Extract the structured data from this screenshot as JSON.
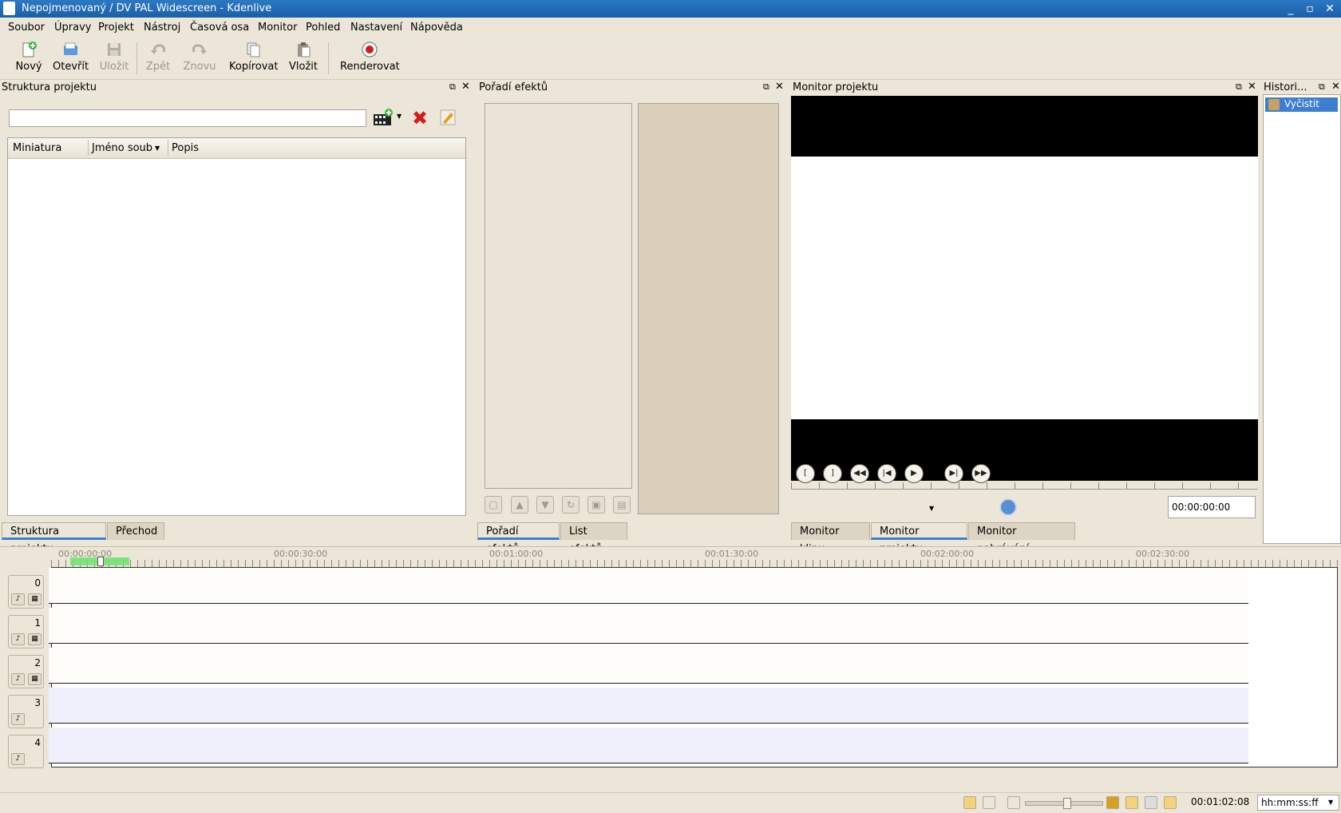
{
  "window": {
    "title": "Nepojmenovaný / DV PAL Widescreen - Kdenlive",
    "controls": [
      "_",
      "▫",
      "✕"
    ]
  },
  "menu": [
    "Soubor",
    "Úpravy",
    "Projekt",
    "Nástroj",
    "Časová osa",
    "Monitor",
    "Pohled",
    "Nastavení",
    "Nápověda"
  ],
  "toolbar": {
    "new": "Nový",
    "open": "Otevřít",
    "save": "Uložit",
    "undo": "Zpět",
    "redo": "Znovu",
    "copy": "Kopírovat",
    "paste": "Vložit",
    "render": "Renderovat"
  },
  "project_tree": {
    "title": "Struktura projektu",
    "search_value": "",
    "columns": [
      "Miniatura",
      "Jméno soub",
      "Popis"
    ],
    "tabs": [
      "Struktura projektu",
      "Přechod"
    ]
  },
  "effect_stack": {
    "title": "Pořadí efektů",
    "tabs": [
      "Pořadí efektů",
      "List efektů"
    ]
  },
  "project_monitor": {
    "title": "Monitor projektu",
    "timecode": "00:00:00:00",
    "tabs": [
      "Monitor klipu",
      "Monitor projektu",
      "Monitor nahrávání"
    ]
  },
  "history": {
    "title": "Histori...",
    "items": [
      "Vyčistit"
    ]
  },
  "timeline": {
    "ruler_labels": [
      "00:00:00:00",
      "00:00:30:00",
      "00:01:00:00",
      "00:01:30:00",
      "00:02:00:00",
      "00:02:30:00"
    ],
    "tracks": [
      {
        "label": "0",
        "type": "video"
      },
      {
        "label": "1",
        "type": "video"
      },
      {
        "label": "2",
        "type": "video"
      },
      {
        "label": "3",
        "type": "audio"
      },
      {
        "label": "4",
        "type": "audio"
      }
    ]
  },
  "statusbar": {
    "duration": "00:01:02:08",
    "time_format": "hh:mm:ss:ff"
  },
  "colors": {
    "titlebar": "#1f65b0",
    "panel_bg": "#ece6d8",
    "video_track": "#fefdfa",
    "audio_track": "#eff0fb",
    "accent": "#3c7fd0"
  }
}
